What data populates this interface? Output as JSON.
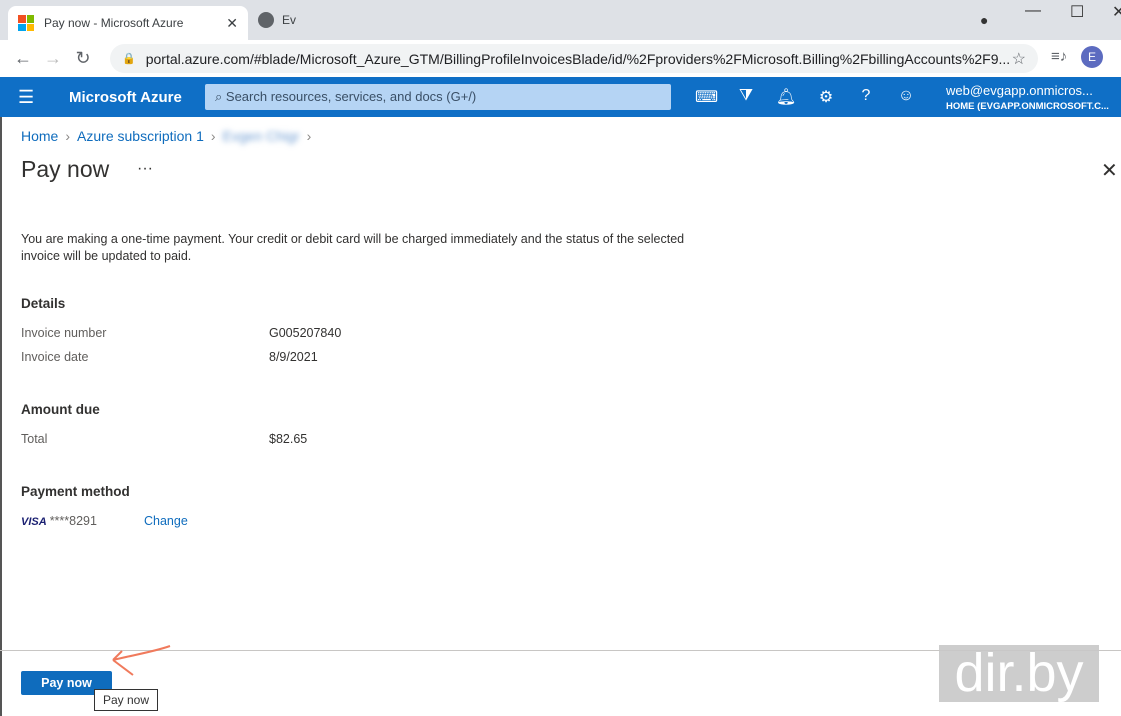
{
  "browser": {
    "tab_title": "Pay now - Microsoft Azure",
    "tab2_title": "Ev",
    "url": "portal.azure.com/#blade/Microsoft_Azure_GTM/BillingProfileInvoicesBlade/id/%2Fproviders%2FMicrosoft.Billing%2FbillingAccounts%2F9...",
    "profile_initial": "E"
  },
  "azure": {
    "brand": "Microsoft Azure",
    "search_placeholder": "Search resources, services, and docs (G+/)",
    "user_email": "web@evgapp.onmicros...",
    "user_tenant": "HOME (EVGAPP.ONMICROSOFT.C..."
  },
  "breadcrumb": [
    "Home",
    "Azure subscription 1",
    "Evgen Chigr"
  ],
  "page": {
    "title": "Pay now",
    "more": "···",
    "notice": "You are making a one-time payment. Your credit or debit card will be charged immediately and the status of the selected invoice will be updated to paid.",
    "details_heading": "Details",
    "invoice_number_label": "Invoice number",
    "invoice_number": "G005207840",
    "invoice_date_label": "Invoice date",
    "invoice_date": "8/9/2021",
    "amount_heading": "Amount due",
    "total_label": "Total",
    "total": "$82.65",
    "payment_heading": "Payment method",
    "card_brand": "VISA",
    "card_number": "****8291",
    "change_label": "Change",
    "pay_button": "Pay now",
    "tooltip": "Pay now"
  },
  "watermark": "dir.by"
}
